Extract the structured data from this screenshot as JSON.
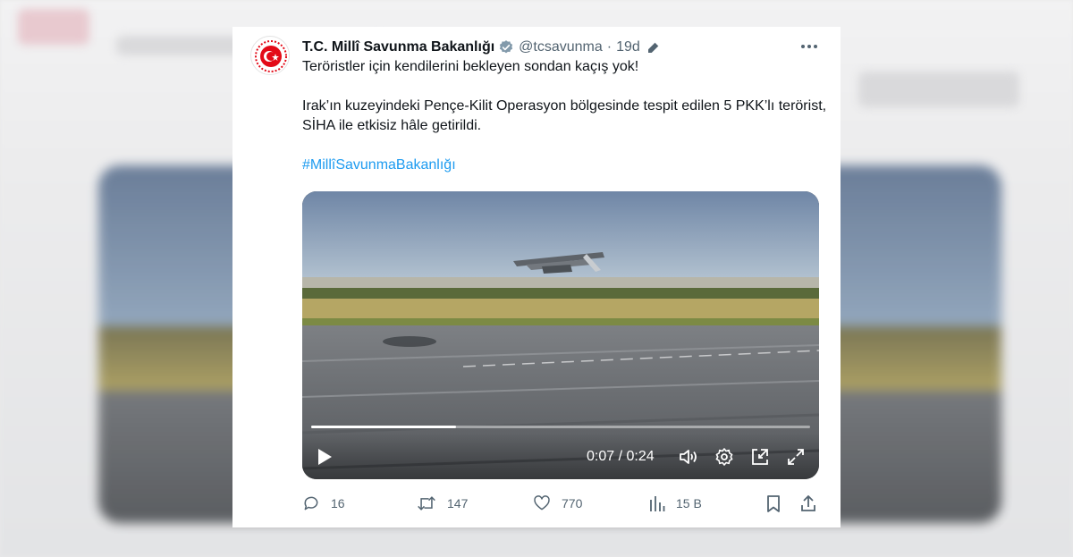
{
  "tweet": {
    "author_name": "T.C. Millî Savunma Bakanlığı",
    "handle": "@tcsavunma",
    "separator": "·",
    "time": "19d",
    "text_line1": "Teröristler için kendilerini bekleyen sondan kaçış yok!",
    "text_line2": "Irak’ın kuzeyindeki Pençe-Kilit Operasyon bölgesinde tespit edilen 5 PKK’lı terörist, SİHA ile etkisiz hâle getirildi.",
    "hashtag": "#MillîSavunmaBakanlığı"
  },
  "video": {
    "current_time": "0:07",
    "duration": "0:24",
    "timecode": "0:07 / 0:24",
    "progress_fraction": 0.29
  },
  "actions": {
    "replies": "16",
    "retweets": "147",
    "likes": "770",
    "views": "15 B"
  },
  "icons": [
    "avatar-emblem",
    "verified-badge-icon",
    "edit-icon",
    "more-icon",
    "play-icon",
    "volume-icon",
    "settings-gear-icon",
    "pip-icon",
    "fullscreen-icon",
    "reply-icon",
    "retweet-icon",
    "like-icon",
    "views-icon",
    "bookmark-icon",
    "share-icon"
  ],
  "colors": {
    "accent": "#1d9bf0",
    "text": "#0f1419",
    "secondary": "#536471",
    "emblem_red": "#e30a17"
  }
}
